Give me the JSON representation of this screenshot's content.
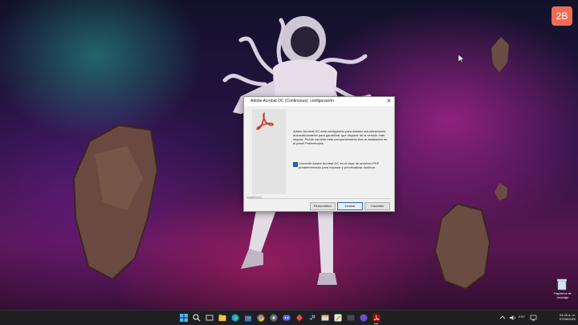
{
  "badge": {
    "text": "2B"
  },
  "dialog": {
    "title": "Adobe Acrobat DC (Continuous): configuración",
    "close_glyph": "✕",
    "info_text": "Adobe Acrobat DC está configurado para instalar actualizaciones automáticamente para garantizar que dispone de la versión más segura. Puede cambiar este comportamiento tras la instalación en el panel Preferencias.",
    "checkbox_label": "Convertir Adobe Acrobat DC en el visor de archivos PDF predeterminado para explorar y previsualizar archivos",
    "checkbox_checked": true,
    "installshield": "InstallShield",
    "buttons": {
      "customize": "Personalizar",
      "install": "Instalar",
      "cancel": "Cancelar"
    }
  },
  "desktop": {
    "recycle_bin_label": "Papelera de reciclaje"
  },
  "taskbar": {
    "language": "ESP",
    "time": "04:28 a. m.",
    "date": "07/06/2020"
  },
  "colors": {
    "badge": "#f06b54",
    "acrobat_red": "#d82c20",
    "taskbar": "#1f1f23",
    "accent": "#2a64c8"
  }
}
